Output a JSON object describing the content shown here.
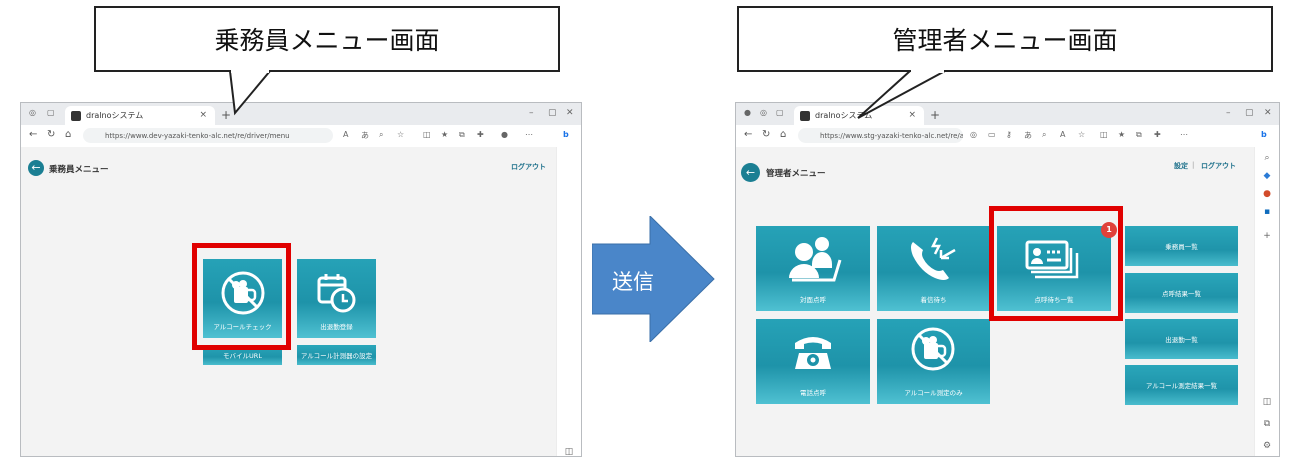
{
  "left_callout": {
    "text": "乗務員メニュー画面"
  },
  "right_callout": {
    "text": "管理者メニュー画面"
  },
  "arrow": {
    "label": "送信",
    "color": "#4a86c9"
  },
  "left_browser": {
    "tab_title": "dralnoシステム",
    "url": "https://www.dev-yazaki-tenko-alc.net/re/driver/menu",
    "page_title": "乗務員メニュー",
    "logout": "ログアウト",
    "tiles": [
      {
        "label": "アルコールチェック",
        "icon": "no-alcohol-icon"
      },
      {
        "label": "出退勤登録",
        "icon": "calendar-clock-icon"
      }
    ],
    "buttons": [
      {
        "label": "モバイルURL"
      },
      {
        "label": "アルコール計測器の設定"
      }
    ]
  },
  "right_browser": {
    "tab_title": "dralnoシステム",
    "url": "https://www.stg-yazaki-tenko-alc.net/re/ad...",
    "page_title": "管理者メニュー",
    "settings": "設定",
    "separator": "|",
    "logout": "ログアウト",
    "tiles": [
      {
        "label": "対面点呼",
        "icon": "face-to-face-icon"
      },
      {
        "label": "着信待ち",
        "icon": "incoming-call-icon"
      },
      {
        "label": "点呼待ち一覧",
        "icon": "id-cards-icon",
        "badge": "1"
      },
      {
        "label": "電話点呼",
        "icon": "telephone-icon"
      },
      {
        "label": "アルコール測定のみ",
        "icon": "no-alcohol-icon"
      }
    ],
    "buttons": [
      {
        "label": "乗務員一覧"
      },
      {
        "label": "点呼結果一覧"
      },
      {
        "label": "出退勤一覧"
      },
      {
        "label": "アルコール測定結果一覧"
      }
    ]
  },
  "colors": {
    "teal": "#1e93a9",
    "highlight": "#e00000",
    "badge": "#e0413a"
  }
}
